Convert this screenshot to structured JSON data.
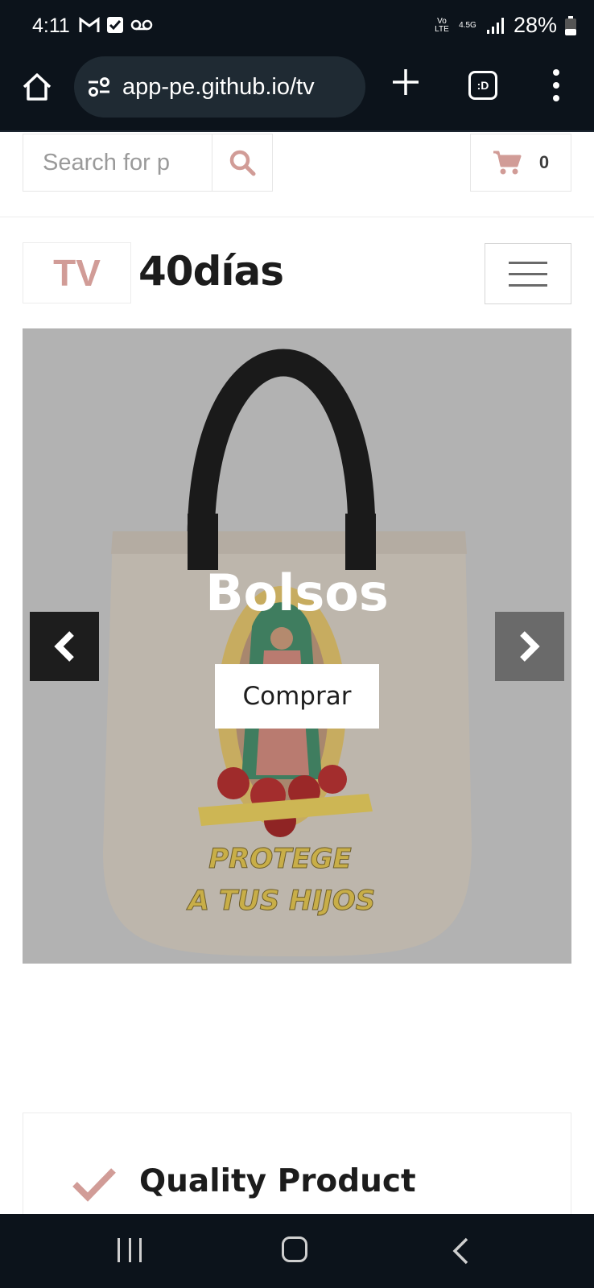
{
  "status_bar": {
    "time": "4:11",
    "battery": "28%",
    "net_top": "4.5G",
    "net_lte": "Vo LTE"
  },
  "browser": {
    "url": "app-pe.github.io/tv",
    "tabs_label": ":D"
  },
  "search": {
    "placeholder": "Search for p"
  },
  "cart": {
    "count": "0"
  },
  "brand": {
    "logo_text": "TV",
    "name": "40días",
    "accent_color": "#d19c97"
  },
  "carousel": {
    "title": "Bolsos",
    "button_label": "Comprar",
    "bag_print_line1": "PROTEGE",
    "bag_print_line2": "A TUS HIJOS"
  },
  "feature": {
    "label": "Quality Product"
  }
}
